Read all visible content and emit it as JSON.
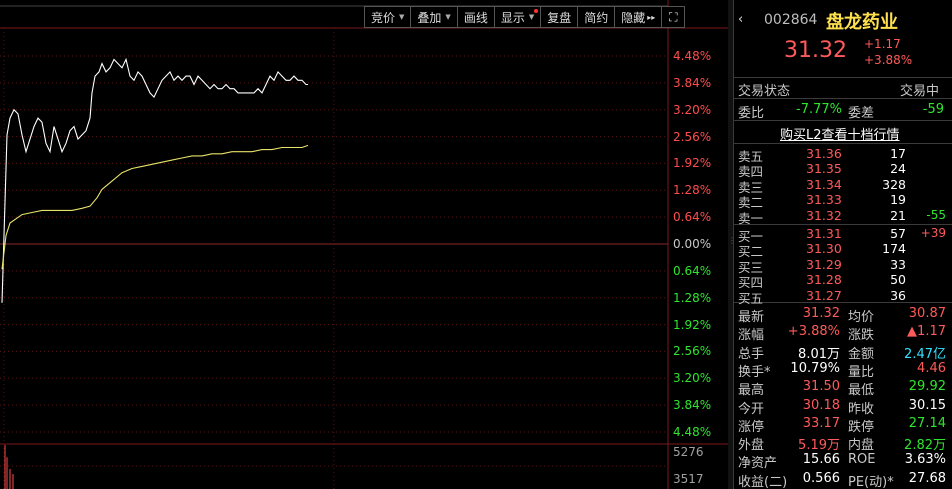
{
  "toolbar": {
    "buttons": [
      {
        "label": "竞价",
        "dropdown": true
      },
      {
        "label": "叠加",
        "dropdown": true
      },
      {
        "label": "画线",
        "dropdown": false
      },
      {
        "label": "显示",
        "dropdown": true,
        "dot": true
      },
      {
        "label": "复盘",
        "dropdown": false
      },
      {
        "label": "简约",
        "dropdown": false
      },
      {
        "label": "隐藏",
        "arrow": "▸▸"
      },
      {
        "label": "",
        "icon": "expand-icon",
        "glyph": "⛶"
      }
    ]
  },
  "chart": {
    "up_labels": [
      "4.48%",
      "3.84%",
      "3.20%",
      "2.56%",
      "1.92%",
      "1.28%",
      "0.64%"
    ],
    "zero_label": "0.00%",
    "down_labels": [
      "0.64%",
      "1.28%",
      "1.92%",
      "2.56%",
      "3.20%",
      "3.84%",
      "4.48%"
    ],
    "volume_labels": [
      "5276",
      "3517"
    ],
    "colors": {
      "up": "#ff4d4d",
      "flat": "#c8c8c8",
      "down": "#2ee62e",
      "price_line": "#ffffff",
      "avg_line": "#e8e36a",
      "grid": "#7a1a1a"
    }
  },
  "chart_data": {
    "type": "line",
    "x_unit": "minutes since open",
    "ylabel": "",
    "ylim": [
      -4.48,
      4.48
    ],
    "series": [
      {
        "name": "",
        "points": [
          [
            0,
            -1.4
          ],
          [
            2,
            0.2
          ],
          [
            5,
            2.6
          ],
          [
            8,
            3.0
          ],
          [
            12,
            3.2
          ],
          [
            16,
            3.1
          ],
          [
            20,
            2.6
          ],
          [
            24,
            2.2
          ],
          [
            28,
            2.5
          ],
          [
            32,
            2.8
          ],
          [
            36,
            3.0
          ],
          [
            40,
            2.9
          ],
          [
            44,
            2.4
          ],
          [
            48,
            2.2
          ],
          [
            52,
            2.8
          ],
          [
            56,
            2.5
          ],
          [
            60,
            2.2
          ],
          [
            64,
            2.4
          ],
          [
            68,
            2.7
          ],
          [
            72,
            2.8
          ],
          [
            76,
            2.5
          ],
          [
            80,
            2.6
          ],
          [
            84,
            2.7
          ],
          [
            88,
            3.0
          ],
          [
            90,
            3.6
          ],
          [
            93,
            4.0
          ],
          [
            97,
            4.1
          ],
          [
            100,
            4.3
          ],
          [
            104,
            4.1
          ],
          [
            108,
            4.2
          ],
          [
            112,
            4.4
          ],
          [
            116,
            4.3
          ],
          [
            120,
            4.2
          ],
          [
            124,
            4.4
          ],
          [
            128,
            4.0
          ],
          [
            132,
            3.9
          ],
          [
            136,
            4.1
          ],
          [
            140,
            4.0
          ],
          [
            144,
            3.8
          ],
          [
            148,
            3.6
          ],
          [
            152,
            3.5
          ],
          [
            156,
            3.7
          ],
          [
            160,
            3.9
          ],
          [
            164,
            4.0
          ],
          [
            168,
            4.1
          ],
          [
            172,
            3.9
          ],
          [
            176,
            4.0
          ],
          [
            180,
            3.9
          ],
          [
            184,
            4.0
          ],
          [
            188,
            4.0
          ],
          [
            192,
            3.8
          ],
          [
            196,
            4.0
          ],
          [
            200,
            3.9
          ],
          [
            204,
            3.8
          ],
          [
            208,
            3.7
          ],
          [
            212,
            3.8
          ],
          [
            216,
            3.7
          ],
          [
            220,
            3.7
          ],
          [
            224,
            3.8
          ],
          [
            228,
            3.7
          ],
          [
            232,
            3.7
          ],
          [
            236,
            3.6
          ],
          [
            240,
            3.6
          ],
          [
            244,
            3.6
          ],
          [
            248,
            3.6
          ],
          [
            252,
            3.6
          ],
          [
            256,
            3.7
          ],
          [
            260,
            3.6
          ],
          [
            264,
            3.8
          ],
          [
            268,
            4.0
          ],
          [
            272,
            3.9
          ],
          [
            276,
            4.1
          ],
          [
            280,
            4.0
          ],
          [
            284,
            3.9
          ],
          [
            288,
            3.9
          ],
          [
            292,
            4.0
          ],
          [
            296,
            3.9
          ],
          [
            300,
            3.9
          ],
          [
            304,
            3.8
          ],
          [
            306,
            3.8
          ]
        ]
      },
      {
        "name": "",
        "points": [
          [
            0,
            -0.6
          ],
          [
            4,
            0.2
          ],
          [
            8,
            0.5
          ],
          [
            14,
            0.6
          ],
          [
            20,
            0.7
          ],
          [
            30,
            0.75
          ],
          [
            40,
            0.8
          ],
          [
            50,
            0.8
          ],
          [
            60,
            0.8
          ],
          [
            70,
            0.8
          ],
          [
            80,
            0.85
          ],
          [
            88,
            0.9
          ],
          [
            95,
            1.1
          ],
          [
            100,
            1.3
          ],
          [
            110,
            1.5
          ],
          [
            120,
            1.7
          ],
          [
            130,
            1.8
          ],
          [
            140,
            1.85
          ],
          [
            150,
            1.9
          ],
          [
            160,
            1.95
          ],
          [
            170,
            2.0
          ],
          [
            180,
            2.05
          ],
          [
            190,
            2.1
          ],
          [
            200,
            2.1
          ],
          [
            210,
            2.15
          ],
          [
            220,
            2.15
          ],
          [
            230,
            2.2
          ],
          [
            240,
            2.2
          ],
          [
            250,
            2.2
          ],
          [
            260,
            2.25
          ],
          [
            270,
            2.25
          ],
          [
            280,
            2.3
          ],
          [
            290,
            2.3
          ],
          [
            300,
            2.3
          ],
          [
            306,
            2.35
          ]
        ]
      }
    ],
    "volume": {
      "max_label": 5276,
      "mid_label": 3517,
      "bars": [
        [
          5,
          5276
        ],
        [
          7,
          3800
        ],
        [
          10,
          2400
        ],
        [
          13,
          1800
        ]
      ]
    }
  },
  "quote": {
    "code": "002864",
    "name": "盘龙药业",
    "price": "31.32",
    "change": "+1.17",
    "change_pct": "+3.88%",
    "status_label": "交易状态",
    "status_value": "交易中",
    "weibi_label": "委比",
    "weibi_value": "-7.77%",
    "weicha_label": "委差",
    "weicha_value": "-59",
    "l2_link": "购买L2查看十档行情",
    "sells": [
      {
        "label": "卖五",
        "price": "31.36",
        "vol": "17",
        "chg": ""
      },
      {
        "label": "卖四",
        "price": "31.35",
        "vol": "24",
        "chg": ""
      },
      {
        "label": "卖三",
        "price": "31.34",
        "vol": "328",
        "chg": ""
      },
      {
        "label": "卖二",
        "price": "31.33",
        "vol": "19",
        "chg": ""
      },
      {
        "label": "卖一",
        "price": "31.32",
        "vol": "21",
        "chg": "-55"
      }
    ],
    "buys": [
      {
        "label": "买一",
        "price": "31.31",
        "vol": "57",
        "chg": "+39"
      },
      {
        "label": "买二",
        "price": "31.30",
        "vol": "174",
        "chg": ""
      },
      {
        "label": "买三",
        "price": "31.29",
        "vol": "33",
        "chg": ""
      },
      {
        "label": "买四",
        "price": "31.28",
        "vol": "50",
        "chg": ""
      },
      {
        "label": "买五",
        "price": "31.27",
        "vol": "36",
        "chg": ""
      }
    ],
    "stats": [
      {
        "l1": "最新",
        "v1": "31.32",
        "c1": "red",
        "l2": "均价",
        "v2": "30.87",
        "c2": "red"
      },
      {
        "l1": "涨幅",
        "v1": "+3.88%",
        "c1": "red",
        "l2": "涨跌",
        "v2": "▲1.17",
        "c2": "red"
      },
      {
        "l1": "总手",
        "v1": "8.01万",
        "c1": "white",
        "l2": "金额",
        "v2": "2.47亿",
        "c2": "cyan"
      },
      {
        "l1": "换手*",
        "v1": "10.79%",
        "c1": "white",
        "l2": "量比",
        "v2": "4.46",
        "c2": "red"
      },
      {
        "l1": "最高",
        "v1": "31.50",
        "c1": "red",
        "l2": "最低",
        "v2": "29.92",
        "c2": "green"
      },
      {
        "l1": "今开",
        "v1": "30.18",
        "c1": "red",
        "l2": "昨收",
        "v2": "30.15",
        "c2": "white"
      },
      {
        "l1": "涨停",
        "v1": "33.17",
        "c1": "red",
        "l2": "跌停",
        "v2": "27.14",
        "c2": "green"
      },
      {
        "l1": "外盘",
        "v1": "5.19万",
        "c1": "red",
        "l2": "内盘",
        "v2": "2.82万",
        "c2": "green"
      },
      {
        "l1": "净资产",
        "v1": "15.66",
        "c1": "white",
        "l2": "ROE",
        "v2": "3.63%",
        "c2": "white"
      },
      {
        "l1": "收益(二)",
        "v1": "0.566",
        "c1": "white",
        "l2": "PE(动)*",
        "v2": "27.68",
        "c2": "white"
      }
    ]
  }
}
